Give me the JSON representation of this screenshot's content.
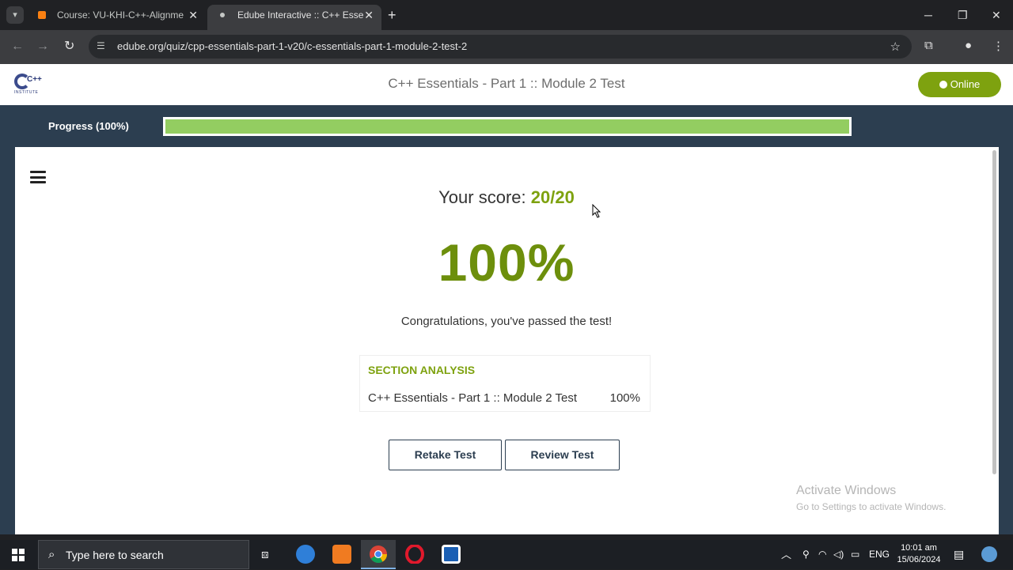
{
  "browser": {
    "tabs": [
      {
        "title": "Course: VU-KHI-C++-Alignme…",
        "active": false
      },
      {
        "title": "Edube Interactive :: C++ Essenti…",
        "active": true
      }
    ],
    "new_tab_icon": "plus-icon",
    "url": "edube.org/quiz/cpp-essentials-part-1-v20/c-essentials-part-1-module-2-test-2"
  },
  "header": {
    "logo_text": "C++",
    "logo_sub": "INSTITUTE",
    "title": "C++ Essentials - Part 1 :: Module 2 Test",
    "status_label": "Online"
  },
  "progress": {
    "label": "Progress (100%)",
    "value": 100
  },
  "result": {
    "score_prefix": "Your score:",
    "score": "20/20",
    "percent": "100%",
    "message": "Congratulations, you've passed the test!"
  },
  "analysis": {
    "heading": "SECTION ANALYSIS",
    "rows": [
      {
        "name": "C++ Essentials - Part 1 :: Module 2 Test",
        "score": "100%"
      }
    ]
  },
  "actions": {
    "retake": "Retake Test",
    "review": "Review Test"
  },
  "watermark": {
    "line1": "Activate Windows",
    "line2": "Go to Settings to activate Windows."
  },
  "taskbar": {
    "search_placeholder": "Type here to search",
    "language": "ENG",
    "time": "10:01 am",
    "date": "15/06/2024"
  },
  "colors": {
    "accent_green": "#7ea20f",
    "progress_fill": "#93cd61",
    "navy": "#2c3e50"
  }
}
